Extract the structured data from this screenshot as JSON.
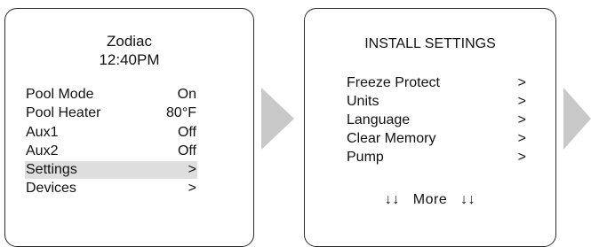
{
  "main_screen": {
    "brand": "Zodiac",
    "time": "12:40PM",
    "menu": [
      {
        "label": "Pool Mode",
        "value": "On"
      },
      {
        "label": "Pool Heater",
        "value": "80°F"
      },
      {
        "label": "Aux1",
        "value": "Off"
      },
      {
        "label": "Aux2",
        "value": "Off"
      },
      {
        "label": "Settings",
        "value": ">",
        "selected": true
      },
      {
        "label": "Devices",
        "value": ">"
      }
    ]
  },
  "install_screen": {
    "title": "INSTALL SETTINGS",
    "menu": [
      {
        "label": "Freeze Protect",
        "value": ">"
      },
      {
        "label": "Units",
        "value": ">"
      },
      {
        "label": "Language",
        "value": ">"
      },
      {
        "label": "Clear Memory",
        "value": ">"
      },
      {
        "label": "Pump",
        "value": ">"
      }
    ],
    "more_label": "More",
    "more_icon": "↓↓"
  },
  "colors": {
    "arrow": "#c8c8c8",
    "highlight": "#dedede",
    "border": "#2a2a2a"
  }
}
